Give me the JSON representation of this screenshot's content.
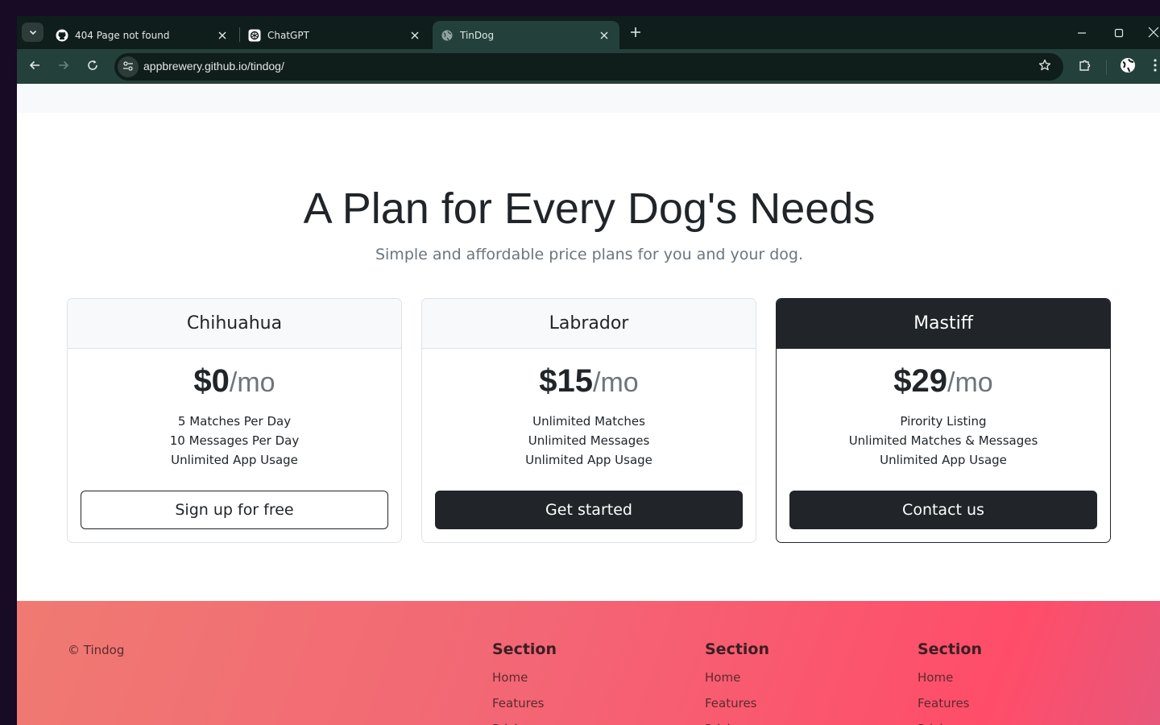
{
  "browser": {
    "tabs": [
      {
        "title": "404 Page not found",
        "icon": "github-icon",
        "active": false
      },
      {
        "title": "ChatGPT",
        "icon": "chatgpt-icon",
        "active": false
      },
      {
        "title": "TinDog",
        "icon": "globe-icon",
        "active": true
      }
    ],
    "url": "appbrewery.github.io/tindog/",
    "colors": {
      "frame": "#0f1e1b",
      "toolbar": "#23413a"
    }
  },
  "pricing": {
    "title": "A Plan for Every Dog's Needs",
    "subtitle": "Simple and affordable price plans for you and your dog.",
    "plans": [
      {
        "name": "Chihuahua",
        "price": "$0",
        "period": "/mo",
        "features": [
          "5 Matches Per Day",
          "10 Messages Per Day",
          "Unlimited App Usage"
        ],
        "button": "Sign up for free"
      },
      {
        "name": "Labrador",
        "price": "$15",
        "period": "/mo",
        "features": [
          "Unlimited Matches",
          "Unlimited Messages",
          "Unlimited App Usage"
        ],
        "button": "Get started"
      },
      {
        "name": "Mastiff",
        "price": "$29",
        "period": "/mo",
        "features": [
          "Pirority Listing",
          "Unlimited Matches & Messages",
          "Unlimited App Usage"
        ],
        "button": "Contact us"
      }
    ]
  },
  "footer": {
    "copyright": "© Tindog",
    "columns": [
      {
        "heading": "Section",
        "links": [
          "Home",
          "Features",
          "Pricing"
        ]
      },
      {
        "heading": "Section",
        "links": [
          "Home",
          "Features",
          "Pricing"
        ]
      },
      {
        "heading": "Section",
        "links": [
          "Home",
          "Features",
          "Pricing"
        ]
      }
    ],
    "colors": {
      "gradient_start": "#f07a72",
      "gradient_end": "#ff4d69"
    }
  }
}
